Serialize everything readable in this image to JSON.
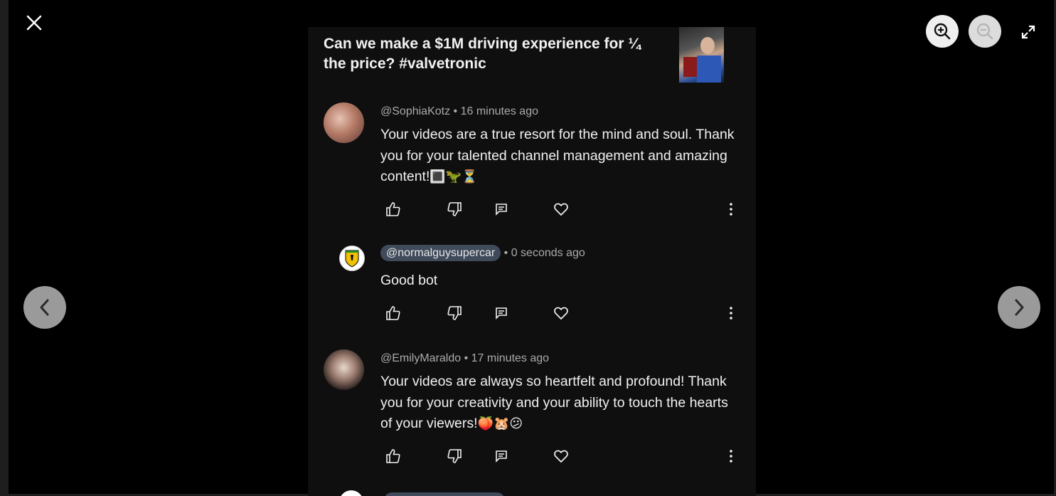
{
  "viewer": {
    "video_title": "Can we make a $1M driving experience for ¼ the price? #valvetronic"
  },
  "comments": [
    {
      "handle": "@SophiaKotz",
      "time": "16 minutes ago",
      "text": "Your videos are a true resort for the mind and soul. Thank you for your talented channel management and amazing content!",
      "emojis": "🔳🦖⏳"
    },
    {
      "handle": "@normalguysupercar",
      "time": "0 seconds ago",
      "text": "Good bot",
      "emojis": ""
    },
    {
      "handle": "@EmilyMaraldo",
      "time": "17 minutes ago",
      "text": "Your videos are always so heartfelt and profound! Thank you for your creativity and your ability to touch the hearts of your viewers!",
      "emojis": "🍑🐹😕"
    }
  ],
  "icons": {
    "close": "close-icon",
    "zoom_in": "zoom-in-icon",
    "zoom_out": "zoom-out-icon",
    "fullscreen": "fullscreen-icon",
    "prev": "chevron-left-icon",
    "next": "chevron-right-icon",
    "like": "thumbs-up-icon",
    "dislike": "thumbs-down-icon",
    "reply": "reply-icon",
    "heart": "heart-icon",
    "more": "more-vertical-icon"
  },
  "colors": {
    "background": "#000000",
    "panel": "#0f0f0f",
    "text_primary": "#f1f1f1",
    "text_secondary": "#aaaaaa",
    "handle_pill": "#3f4a5a",
    "nav_button": "#9a9a9a"
  }
}
